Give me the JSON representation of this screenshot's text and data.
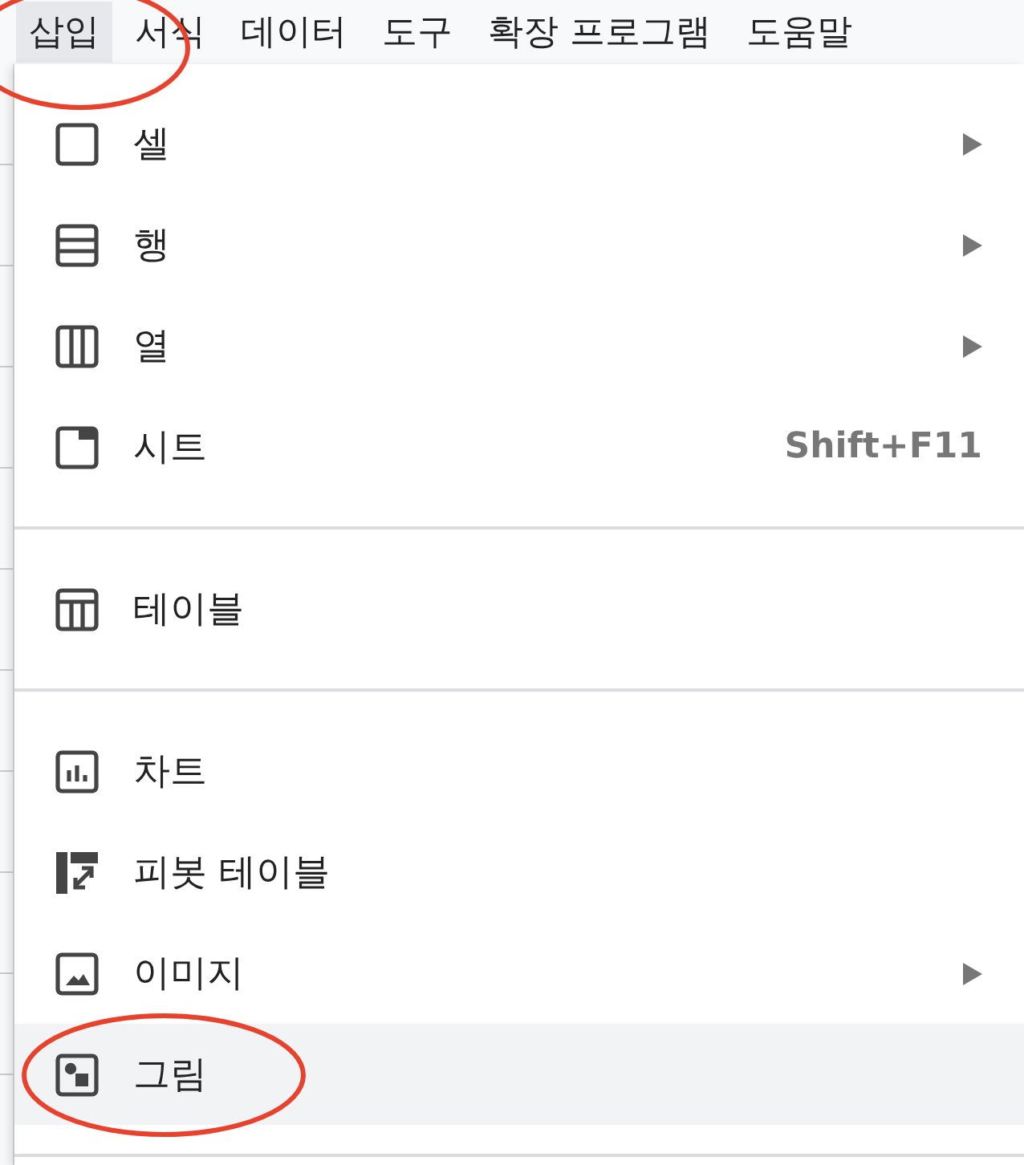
{
  "menu_bar": [
    {
      "label": "삽입",
      "selected": true
    },
    {
      "label": "서식",
      "selected": false
    },
    {
      "label": "데이터",
      "selected": false
    },
    {
      "label": "도구",
      "selected": false
    },
    {
      "label": "확장 프로그램",
      "selected": false
    },
    {
      "label": "도움말",
      "selected": false
    }
  ],
  "menu": {
    "groups": [
      {
        "items": [
          {
            "label": "셀",
            "submenu": true,
            "highlighted": false
          },
          {
            "label": "행",
            "submenu": true,
            "highlighted": false
          },
          {
            "label": "열",
            "submenu": true,
            "highlighted": false
          },
          {
            "label": "시트",
            "submenu": false,
            "shortcut": "Shift+F11",
            "highlighted": false
          }
        ]
      },
      {
        "items": [
          {
            "label": "테이블",
            "submenu": false,
            "highlighted": false
          }
        ]
      },
      {
        "items": [
          {
            "label": "차트",
            "submenu": false,
            "highlighted": false
          },
          {
            "label": "피봇 테이블",
            "submenu": false,
            "highlighted": false
          },
          {
            "label": "이미지",
            "submenu": true,
            "highlighted": false
          },
          {
            "label": "그림",
            "submenu": false,
            "highlighted": true
          }
        ]
      }
    ]
  }
}
